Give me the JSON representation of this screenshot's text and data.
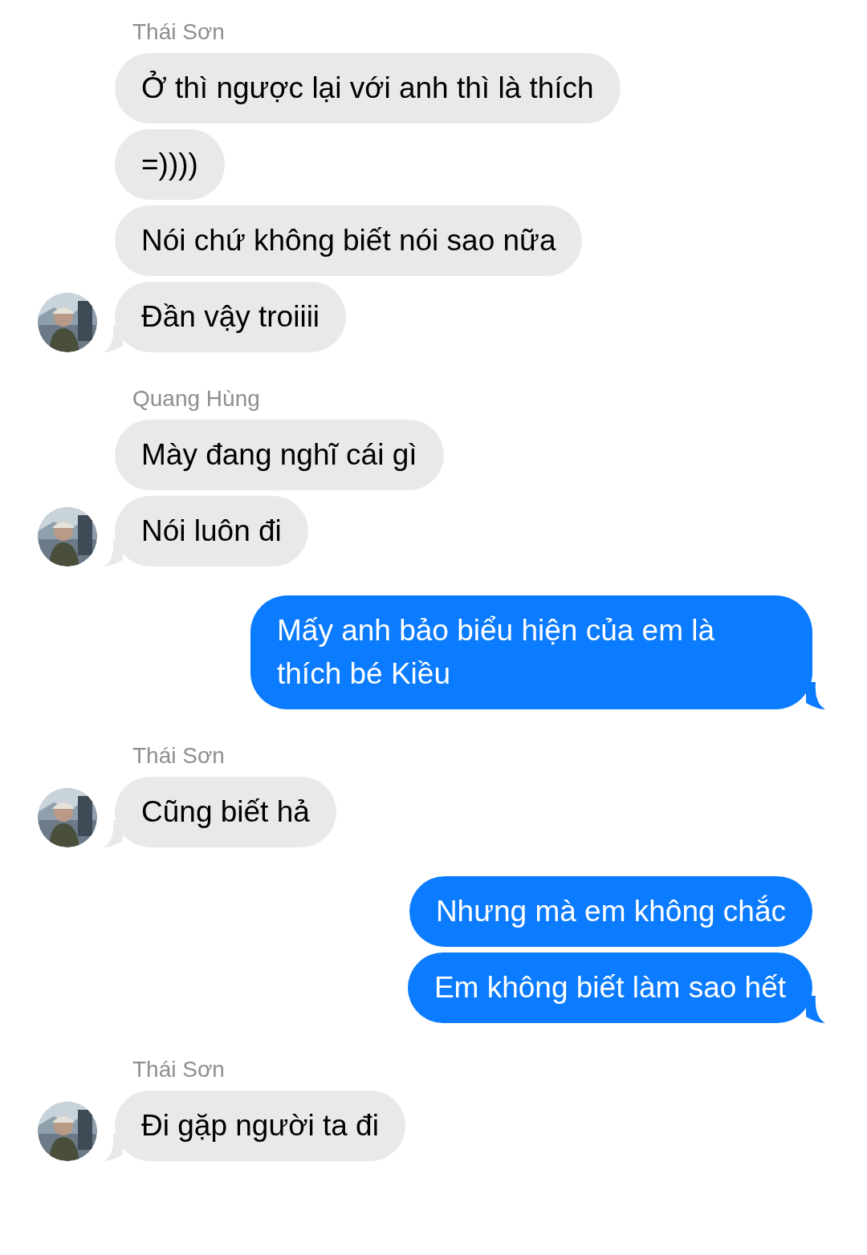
{
  "groups": [
    {
      "kind": "incoming",
      "sender": "Thái Sơn",
      "messages": [
        "Ở thì ngược lại với anh thì là thích",
        "=))))",
        "Nói chứ không biết nói sao nữa",
        "Đần vậy troiiii"
      ]
    },
    {
      "kind": "incoming",
      "sender": "Quang Hùng",
      "messages": [
        "Mày đang nghĩ cái gì",
        "Nói luôn đi"
      ]
    },
    {
      "kind": "outgoing",
      "messages": [
        "Mấy anh bảo biểu hiện của em là thích bé Kiều"
      ]
    },
    {
      "kind": "incoming",
      "sender": "Thái Sơn",
      "messages": [
        "Cũng biết hả"
      ]
    },
    {
      "kind": "outgoing",
      "messages": [
        "Nhưng mà em không chắc",
        "Em không biết làm sao hết"
      ]
    },
    {
      "kind": "incoming",
      "sender": "Thái Sơn",
      "messages": [
        "Đi gặp người ta đi"
      ]
    }
  ]
}
